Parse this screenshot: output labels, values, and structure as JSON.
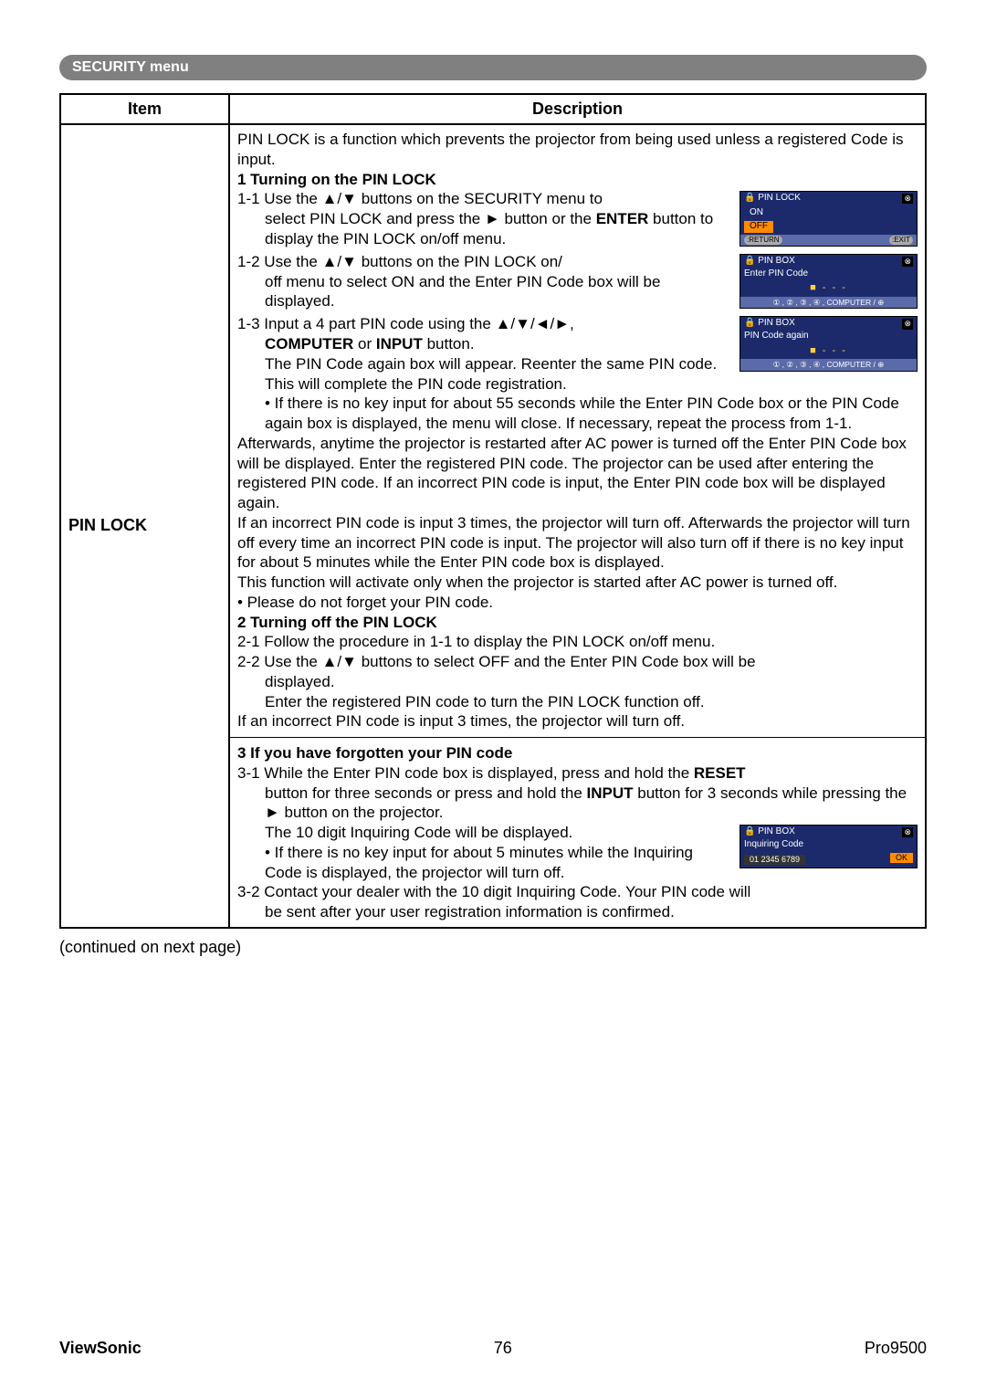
{
  "menuHeader": "SECURITY menu",
  "table": {
    "headers": {
      "item": "Item",
      "description": "Description"
    },
    "itemName": "PIN LOCK",
    "intro": "PIN LOCK is a function which prevents the projector from being used unless a registered Code is input.",
    "s1": {
      "title": "1 Turning on the PIN LOCK",
      "l11a": "1-1 Use the ▲/▼ buttons on the SECURITY menu to",
      "l11b": "select PIN LOCK and press the ► button or the ",
      "l11c_strong": "ENTER",
      "l11c_rest": " button to display the PIN LOCK on/off menu.",
      "l12a": "1-2 Use the ▲/▼ buttons on the PIN LOCK on/",
      "l12b": "off menu to select ON and the Enter PIN Code box will be displayed.",
      "l13a": "1-3 Input a 4 part PIN code using the ▲/▼/◄/►,",
      "l13b_strong": "COMPUTER",
      "l13b_mid": " or ",
      "l13b_strong2": "INPUT",
      "l13b_rest": " button.",
      "l13c": "The PIN Code again box will appear. Reenter the same PIN code. This will complete the PIN code registration.",
      "bullet1": "• If there is no key input for about 55 seconds while the Enter PIN Code box or the PIN Code again box is displayed, the menu will close. If necessary, repeat the process from 1-1.",
      "para1": "Afterwards, anytime the projector is restarted after AC power  is turned off the Enter PIN Code box will be displayed. Enter the registered PIN code. The projector can be used after entering the registered PIN code. If an incorrect PIN code is input, the Enter PIN code box will be displayed again.",
      "para2": "If an incorrect PIN code is input 3 times, the projector will turn off. Afterwards the projector will turn off every time an incorrect PIN code is input. The projector will also turn off if there is no key input for about 5 minutes while the Enter PIN code box is displayed.",
      "para3": "This function will activate only when the projector is started after AC power is turned off.",
      "bullet2": "• Please do not forget your PIN code."
    },
    "s2": {
      "title": "2 Turning off the PIN LOCK",
      "l21": "2-1 Follow the procedure in 1-1 to display the PIN LOCK on/off menu.",
      "l22a": "2-2 Use the ▲/▼ buttons to select OFF and the Enter PIN Code box will be",
      "l22b": "displayed.",
      "l22c": "Enter the registered PIN code to turn the PIN LOCK function off.",
      "l23": "If an incorrect PIN code is input 3 times, the projector will turn off."
    },
    "s3": {
      "title": "3 If you have forgotten your PIN code",
      "l31a": "3-1 While the Enter PIN code box is displayed, press and hold the ",
      "l31a_strong": "RESET",
      "l31b": "button for three seconds or press and hold the ",
      "l31b_strong": "INPUT",
      "l31b_rest": " button for 3 seconds while pressing the ► button on the projector.",
      "l31c": "The 10 digit Inquiring Code will be displayed.",
      "bullet": "• If there is no key input for about 5 minutes while the Inquiring Code is displayed, the projector will turn off.",
      "l32": "3-2 Contact your dealer with the 10 digit Inquiring Code. Your PIN code will",
      "l32b": "be sent after your user registration information is confirmed."
    }
  },
  "osd": {
    "pinlock": {
      "title": "PIN LOCK",
      "on": "ON",
      "off": "OFF",
      "return": ":RETURN",
      "exit": ":EXIT"
    },
    "enter": {
      "title": "PIN BOX",
      "sub": "Enter PIN Code",
      "dashes": "■ - - -",
      "hint": "① , ② , ③ , ④ , COMPUTER / ⊕"
    },
    "again": {
      "title": "PIN BOX",
      "sub": "PIN Code again",
      "dashes": "■ - - -",
      "hint": "① , ② , ③ , ④ , COMPUTER / ⊕"
    },
    "inquire": {
      "title": "PIN BOX",
      "sub": "Inquiring Code",
      "code": "01 2345 6789",
      "ok": "OK"
    }
  },
  "continued": "(continued on next page)",
  "footer": {
    "brand": "ViewSonic",
    "page": "76",
    "model": "Pro9500"
  }
}
